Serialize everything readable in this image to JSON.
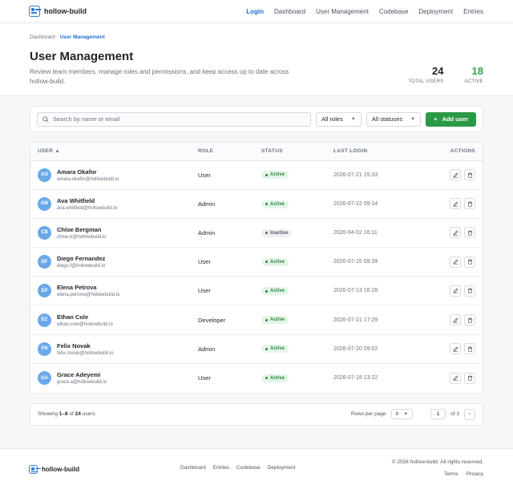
{
  "app": {
    "name": "hollow-build"
  },
  "nav": [
    {
      "label": "Login",
      "active": true
    },
    {
      "label": "Dashboard",
      "active": false
    },
    {
      "label": "User Management",
      "active": false
    },
    {
      "label": "Codebase",
      "active": false
    },
    {
      "label": "Deployment",
      "active": false
    },
    {
      "label": "Entries",
      "active": false
    }
  ],
  "breadcrumb": {
    "root": "Dashboard",
    "current": "User Management"
  },
  "page": {
    "title": "User Management",
    "description": "Review team members, manage roles and permissions, and keep access up to date across hollow-build."
  },
  "stats": {
    "total": {
      "value": "24",
      "label": "TOTAL USERS"
    },
    "active": {
      "value": "18",
      "label": "ACTIVE"
    }
  },
  "toolbar": {
    "search_placeholder": "Search by name or email",
    "role_filter": "All roles",
    "status_filter": "All statuses",
    "add_label": "Add user"
  },
  "table": {
    "columns": {
      "user": "USER",
      "role": "ROLE",
      "status": "STATUS",
      "last_login": "LAST LOGIN",
      "actions": "ACTIONS"
    },
    "rows": [
      {
        "initials": "AO",
        "name": "Amara Okafor",
        "email": "amara.okafor@hollowbuild.io",
        "role": "User",
        "status": "Active",
        "last_login": "2026-07-21 15:33"
      },
      {
        "initials": "AW",
        "name": "Ava Whitfield",
        "email": "ava.whitfield@hollowbuild.io",
        "role": "Admin",
        "status": "Active",
        "last_login": "2026-07-22 09:14"
      },
      {
        "initials": "CB",
        "name": "Chloe Bergman",
        "email": "chloe.b@hollowbuild.io",
        "role": "Admin",
        "status": "Inactive",
        "last_login": "2026-04-02 16:11"
      },
      {
        "initials": "DF",
        "name": "Diego Fernandez",
        "email": "diego.f@hollowbuild.io",
        "role": "User",
        "status": "Active",
        "last_login": "2026-07-15 09:39"
      },
      {
        "initials": "EP",
        "name": "Elena Petrova",
        "email": "elena.petrova@hollowbuild.io",
        "role": "User",
        "status": "Active",
        "last_login": "2026-07-13 16:28"
      },
      {
        "initials": "EC",
        "name": "Ethan Cole",
        "email": "ethan.cole@hollowbuild.io",
        "role": "Developer",
        "status": "Active",
        "last_login": "2026-07-21 17:29"
      },
      {
        "initials": "FN",
        "name": "Felix Novak",
        "email": "felix.novak@hollowbuild.io",
        "role": "Admin",
        "status": "Active",
        "last_login": "2026-07-20 09:02"
      },
      {
        "initials": "GA",
        "name": "Grace Adeyemi",
        "email": "grace.a@hollowbuild.io",
        "role": "User",
        "status": "Active",
        "last_login": "2026-07-18 13:22"
      }
    ]
  },
  "pagination": {
    "showing_prefix": "Showing",
    "range_start": "1",
    "range_sep": "–",
    "range_end": "8",
    "of_word": "of",
    "total": "24",
    "suffix": "users",
    "rows_per_page_label": "Rows per page",
    "rows_per_page": "8",
    "current_page": "1",
    "of_pages": "of 3"
  },
  "footer": {
    "links": [
      "Dashboard",
      "Entries",
      "Codebase",
      "Deployment"
    ],
    "copyright": "© 2026 hollow-build. All rights reserved.",
    "legal": [
      "Terms",
      "Privacy"
    ]
  },
  "colors": {
    "accent": "#1f6fd1",
    "primary_button": "#2b9a46",
    "active_badge": "#2b8a42",
    "avatar": "#6aa9e9"
  }
}
